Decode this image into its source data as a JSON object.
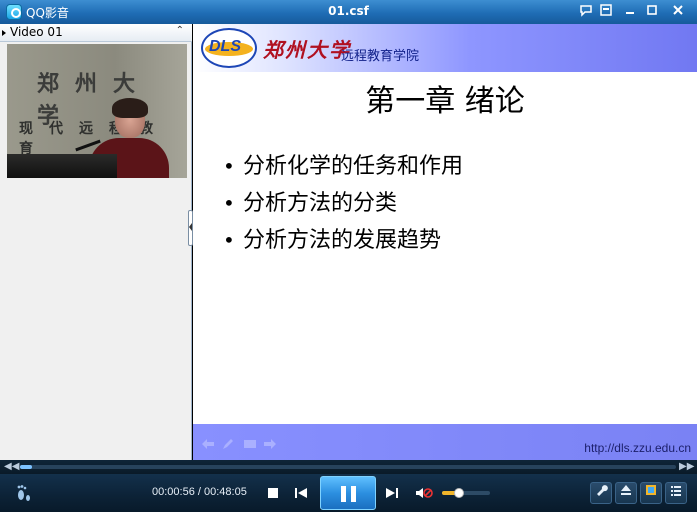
{
  "window": {
    "app_name": "QQ影音",
    "file_title": "01.csf",
    "buttons": [
      "chat-icon",
      "skin-icon",
      "minimize-icon",
      "maximize-icon",
      "close-icon"
    ]
  },
  "left_panel": {
    "title": "Video 01",
    "video_sign_line1": "郑州大学",
    "video_sign_line2": "现代远程教育"
  },
  "slide": {
    "logo_text": "DLS",
    "university": "郑州大学",
    "school": "远程教育学院",
    "title": "第一章  绪论",
    "bullets": [
      "分析化学的任务和作用",
      "分析方法的分类",
      "分析方法的发展趋势"
    ],
    "bullet_symbol": "•",
    "nav_icons": [
      "back-arrow-icon",
      "pen-icon",
      "screen-icon",
      "forward-arrow-icon"
    ],
    "footer_url": "http://dls.zzu.edu.cn",
    "header_color": "#7178f2",
    "footer_color": "#8890ff"
  },
  "player": {
    "time": "00:00:56 / 00:48:05",
    "progress_fraction": 0.019,
    "volume_fraction": 0.35,
    "accent_color": "#2c8fe0"
  }
}
